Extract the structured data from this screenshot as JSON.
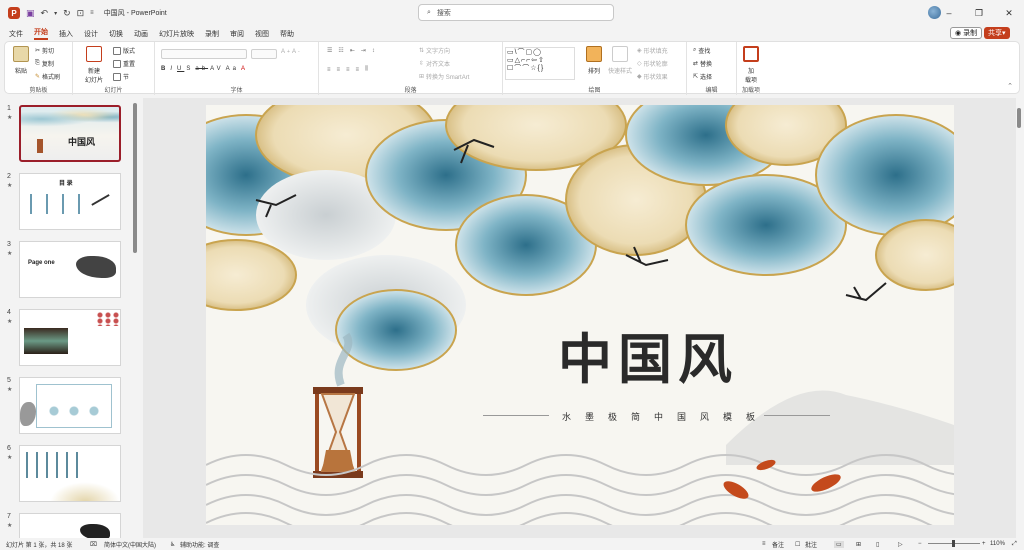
{
  "window": {
    "doc_title": "中国风",
    "app_name": "PowerPoint",
    "separator": "-"
  },
  "search": {
    "placeholder": "搜索"
  },
  "menu": {
    "tabs": [
      "文件",
      "开始",
      "插入",
      "设计",
      "切换",
      "动画",
      "幻灯片放映",
      "录制",
      "审阅",
      "视图",
      "帮助"
    ],
    "active": "开始"
  },
  "actions": {
    "record": "录制",
    "share": "共享"
  },
  "ribbon": {
    "clipboard": {
      "label": "剪贴板",
      "paste": "粘贴",
      "cut": "剪切",
      "copy": "复制",
      "format_painter": "格式刷"
    },
    "slides": {
      "label": "幻灯片",
      "new_slide": "新建\n幻灯片",
      "layout": "版式",
      "reset": "重置",
      "section": "节"
    },
    "font": {
      "label": "字体"
    },
    "paragraph": {
      "label": "段落",
      "text_direction": "文字方向",
      "align_text": "对齐文本",
      "smartart": "转换为 SmartArt"
    },
    "drawing": {
      "label": "绘图",
      "arrange": "排列",
      "quick_styles": "快速样式",
      "shape_fill": "形状填充",
      "shape_outline": "形状轮廓",
      "shape_effects": "形状效果"
    },
    "editing": {
      "label": "编辑",
      "find": "查找",
      "replace": "替换",
      "select": "选择"
    },
    "addins": {
      "label": "加载项",
      "addin": "加\n载项"
    }
  },
  "thumbnails": [
    {
      "num": "1",
      "title": "中国风"
    },
    {
      "num": "2",
      "title": "目 录"
    },
    {
      "num": "3",
      "title": "Page one"
    },
    {
      "num": "4",
      "title": ""
    },
    {
      "num": "5",
      "title": ""
    },
    {
      "num": "6",
      "title": ""
    },
    {
      "num": "7",
      "title": ""
    }
  ],
  "slide": {
    "title": "中国风",
    "subtitle": "水墨极简中国风模板"
  },
  "status": {
    "slide_info": "幻灯片 第 1 张，共 18 张",
    "language": "简体中文(中国大陆)",
    "accessibility": "辅助功能: 调查",
    "notes": "备注",
    "comments": "批注",
    "zoom": "110%"
  },
  "colors": {
    "accent": "#c43e1c",
    "selection": "#9b1e2a",
    "ink_blue": "#5a9bb0",
    "cloud_cream": "#efe3c2"
  }
}
